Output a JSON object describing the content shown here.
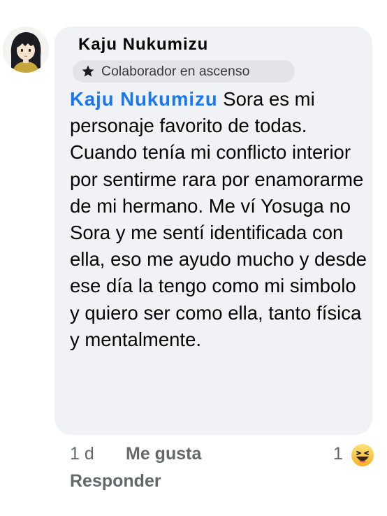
{
  "comment": {
    "author": "Kaju Nukumizu",
    "badge_label": "Colaborador en ascenso",
    "badge_icon": "star-icon",
    "mention": "Kaju Nukumizu",
    "text": "Sora es mi personaje favorito de todas. Cuando tenía mi conflicto interior por sentirme rara por enamorarme de mi hermano. Me ví Yosuga no Sora y me sentí identificada con ella, eso me ayudo mucho y desde ese día la tengo como mi simbolo y quiero ser como ella, tanto física y mentalmente.",
    "timestamp": "1 d",
    "like_label": "Me gusta",
    "reply_label": "Responder",
    "reaction_count": "1",
    "reaction_icon": "haha-emoji-icon"
  },
  "colors": {
    "bubble": "#f0f2f5",
    "mention": "#1877f2",
    "meta_text": "#65676b"
  }
}
